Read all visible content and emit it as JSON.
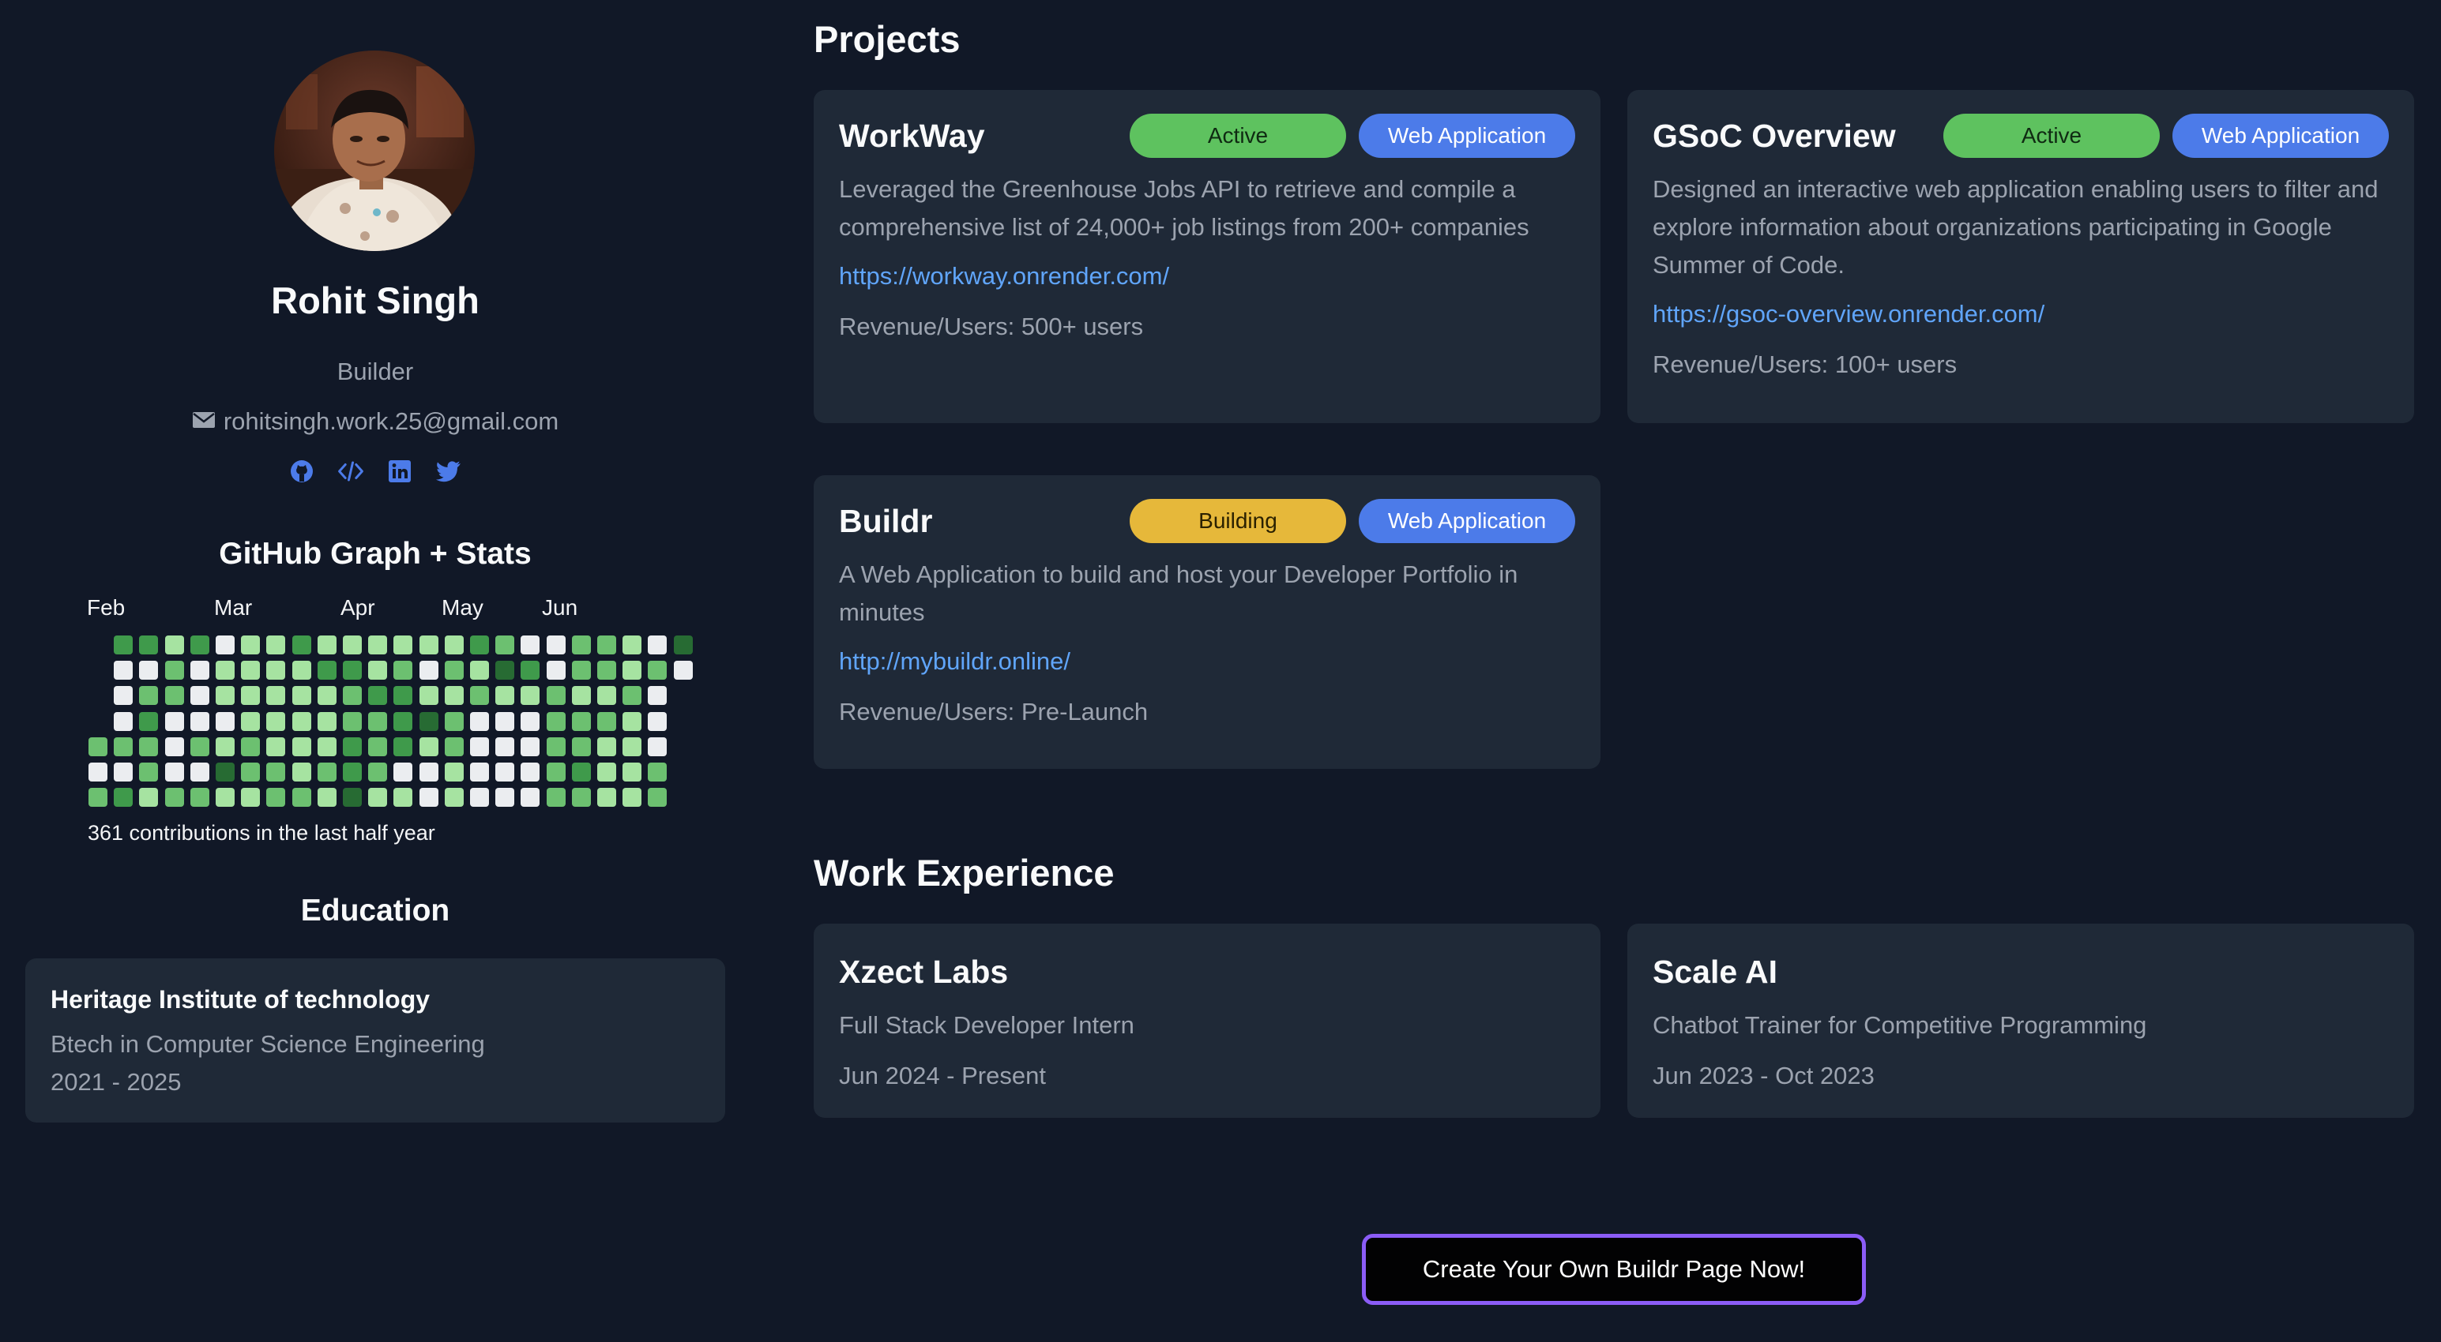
{
  "profile": {
    "name": "Rohit Singh",
    "role": "Builder",
    "email": "rohitsingh.work.25@gmail.com",
    "social": [
      "github-icon",
      "code-icon",
      "linkedin-icon",
      "twitter-icon"
    ]
  },
  "github": {
    "title": "GitHub Graph + Stats",
    "months": [
      "Feb",
      "Mar",
      "Apr",
      "May",
      "Jun"
    ],
    "caption": "361 contributions in the last half year",
    "level_colors": [
      "#ebedf0",
      "#a6e3a1",
      "#6cc070",
      "#3f9a4b",
      "#276b33"
    ],
    "weeks": [
      [
        null,
        null,
        null,
        null,
        2,
        0,
        2
      ],
      [
        3,
        0,
        0,
        0,
        2,
        0,
        3
      ],
      [
        3,
        0,
        2,
        3,
        2,
        2,
        1
      ],
      [
        1,
        2,
        2,
        0,
        0,
        0,
        2
      ],
      [
        3,
        0,
        0,
        0,
        2,
        0,
        2
      ],
      [
        0,
        1,
        1,
        0,
        1,
        4,
        1
      ],
      [
        1,
        1,
        1,
        1,
        2,
        2,
        1
      ],
      [
        1,
        1,
        1,
        1,
        1,
        2,
        2
      ],
      [
        3,
        1,
        1,
        1,
        1,
        1,
        2
      ],
      [
        1,
        3,
        1,
        1,
        1,
        2,
        1
      ],
      [
        1,
        3,
        2,
        2,
        3,
        3,
        4
      ],
      [
        1,
        1,
        3,
        2,
        2,
        2,
        1
      ],
      [
        1,
        2,
        3,
        3,
        3,
        0,
        1
      ],
      [
        1,
        0,
        1,
        4,
        1,
        0,
        0
      ],
      [
        1,
        2,
        1,
        2,
        2,
        1,
        1
      ],
      [
        3,
        1,
        2,
        0,
        0,
        0,
        0
      ],
      [
        2,
        4,
        1,
        0,
        0,
        0,
        0
      ],
      [
        0,
        3,
        1,
        0,
        0,
        0,
        0
      ],
      [
        0,
        0,
        2,
        2,
        2,
        2,
        2
      ],
      [
        2,
        2,
        1,
        2,
        2,
        3,
        2
      ],
      [
        2,
        2,
        1,
        2,
        1,
        1,
        1
      ],
      [
        1,
        1,
        2,
        1,
        1,
        1,
        1
      ],
      [
        0,
        2,
        0,
        0,
        0,
        2,
        2
      ],
      [
        4,
        0,
        null,
        null,
        null,
        null,
        null
      ]
    ]
  },
  "education": {
    "title": "Education",
    "school": "Heritage Institute of technology",
    "degree": "Btech in Computer Science Engineering",
    "years": "2021 - 2025"
  },
  "projects": {
    "title": "Projects",
    "items": [
      {
        "title": "WorkWay",
        "status": "Active",
        "type": "Web Application",
        "description": "Leveraged the Greenhouse Jobs API to retrieve and compile a comprehensive list of 24,000+ job listings from 200+ companies",
        "link": "https://workway.onrender.com/",
        "metric": "Revenue/Users: 500+ users"
      },
      {
        "title": "GSoC Overview",
        "status": "Active",
        "type": "Web Application",
        "description": "Designed an interactive web application enabling users to filter and explore information about organizations participating in Google Summer of Code.",
        "link": "https://gsoc-overview.onrender.com/",
        "metric": "Revenue/Users: 100+ users"
      },
      {
        "title": "Buildr",
        "status": "Building",
        "type": "Web Application",
        "description": "A Web Application to build and host your Developer Portfolio in minutes",
        "link": "http://mybuildr.online/",
        "metric": "Revenue/Users: Pre-Launch"
      }
    ]
  },
  "experience": {
    "title": "Work Experience",
    "items": [
      {
        "company": "Xzect Labs",
        "role": "Full Stack Developer Intern",
        "dates": "Jun 2024 - Present"
      },
      {
        "company": "Scale AI",
        "role": "Chatbot Trainer for Competitive Programming",
        "dates": "Jun 2023 - Oct 2023"
      }
    ]
  },
  "cta": {
    "label": "Create Your Own Buildr Page Now!"
  },
  "colors": {
    "background": "#111827",
    "card": "#1f2937",
    "muted_text": "#9ca3af",
    "link": "#60a5fa",
    "active": "#5ec25f",
    "building": "#e6b83a",
    "type_badge": "#4c7be9",
    "cta_border": "#8b5cf6"
  }
}
